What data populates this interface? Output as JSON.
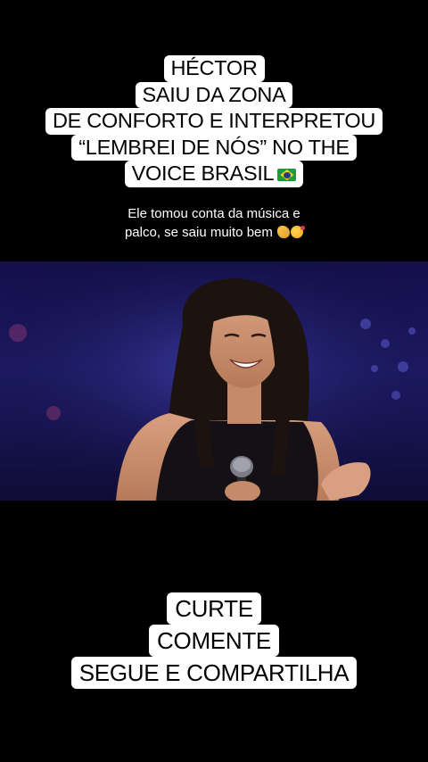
{
  "headline": {
    "lines": [
      "HÉCTOR",
      "SAIU DA ZONA",
      "DE CONFORTO E INTERPRETOU",
      "“LEMBREI DE NÓS” NO THE",
      "VOICE BRASIL"
    ],
    "flag_icon": "brazil-flag-emoji"
  },
  "caption": {
    "line1": "Ele tomou conta da música e",
    "line2": "palco, se saiu muito bem",
    "emojis": [
      "pinching-hand-emoji",
      "smiling-face-with-hearts-emoji"
    ]
  },
  "video": {
    "content": "singer-performing-with-microphone"
  },
  "cta": {
    "lines": [
      "CURTE",
      "COMENTE",
      "SEGUE E COMPARTILHA"
    ]
  },
  "colors": {
    "background": "#000000",
    "label_background": "#ffffff",
    "label_text": "#000000",
    "caption_text": "#ffffff",
    "stage_blue": "#1d1a66"
  }
}
